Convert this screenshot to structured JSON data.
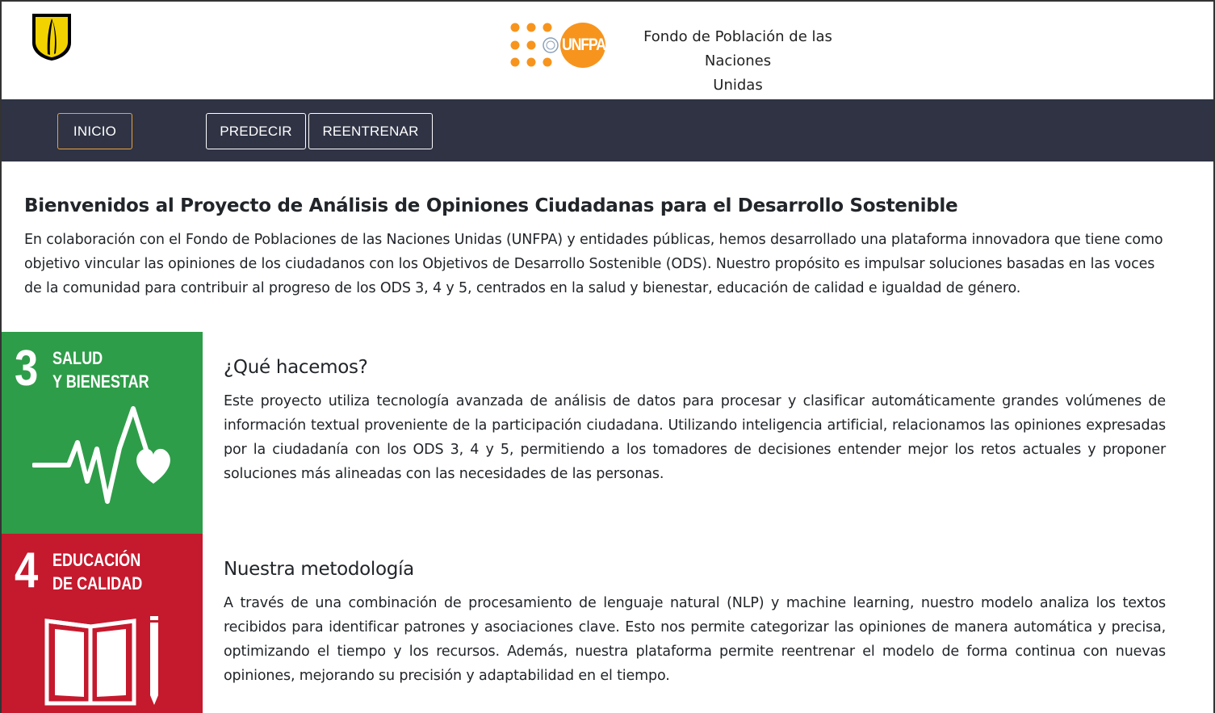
{
  "header": {
    "logo_text": "UNFPA",
    "org_title_line1": "Fondo de Población de las Naciones",
    "org_title_line2": "Unidas"
  },
  "nav": {
    "items": [
      {
        "label": "INICIO",
        "active": true
      },
      {
        "label": "PREDECIR",
        "active": false
      },
      {
        "label": "REENTRENAR",
        "active": false
      }
    ]
  },
  "intro": {
    "title": "Bienvenidos al Proyecto de Análisis de Opiniones Ciudadanas para el Desarrollo Sostenible",
    "text": "En colaboración con el Fondo de Poblaciones de las Naciones Unidas (UNFPA) y entidades públicas, hemos desarrollado una plataforma innovadora que tiene como objetivo vincular las opiniones de los ciudadanos con los Objetivos de Desarrollo Sostenible (ODS). Nuestro propósito es impulsar soluciones basadas en las voces de la comunidad para contribuir al progreso de los ODS 3, 4 y 5, centrados en la salud y bienestar, educación de calidad e igualdad de género."
  },
  "sdg_tiles": [
    {
      "number": "3",
      "label_line1": "SALUD",
      "label_line2": "Y BIENESTAR",
      "color": "#2e9d49",
      "icon": "heartbeat-icon"
    },
    {
      "number": "4",
      "label_line1": "EDUCACIÓN",
      "label_line2": "DE CALIDAD",
      "color": "#c5192d",
      "icon": "book-pencil-icon"
    }
  ],
  "sections": [
    {
      "title": "¿Qué hacemos?",
      "text": "Este proyecto utiliza tecnología avanzada de análisis de datos para procesar y clasificar automáticamente grandes volúmenes de información textual proveniente de la participación ciudadana. Utilizando inteligencia artificial, relacionamos las opiniones expresadas por la ciudadanía con los ODS 3, 4 y 5, permitiendo a los tomadores de decisiones entender mejor los retos actuales y proponer soluciones más alineadas con las necesidades de las personas."
    },
    {
      "title": "Nuestra metodología",
      "text": "A través de una combinación de procesamiento de lenguaje natural (NLP) y machine learning, nuestro modelo analiza los textos recibidos para identificar patrones y asociaciones clave. Esto nos permite categorizar las opiniones de manera automática y precisa, optimizando el tiempo y los recursos. Además, nuestra plataforma permite reentrenar el modelo de forma continua con nuevas opiniones, mejorando su precisión y adaptabilidad en el tiempo."
    }
  ],
  "colors": {
    "nav_bg": "#2f3344",
    "active_border": "#e8a33b",
    "unfpa_orange": "#f7941d",
    "sdg3": "#2e9d49",
    "sdg4": "#c5192d"
  }
}
